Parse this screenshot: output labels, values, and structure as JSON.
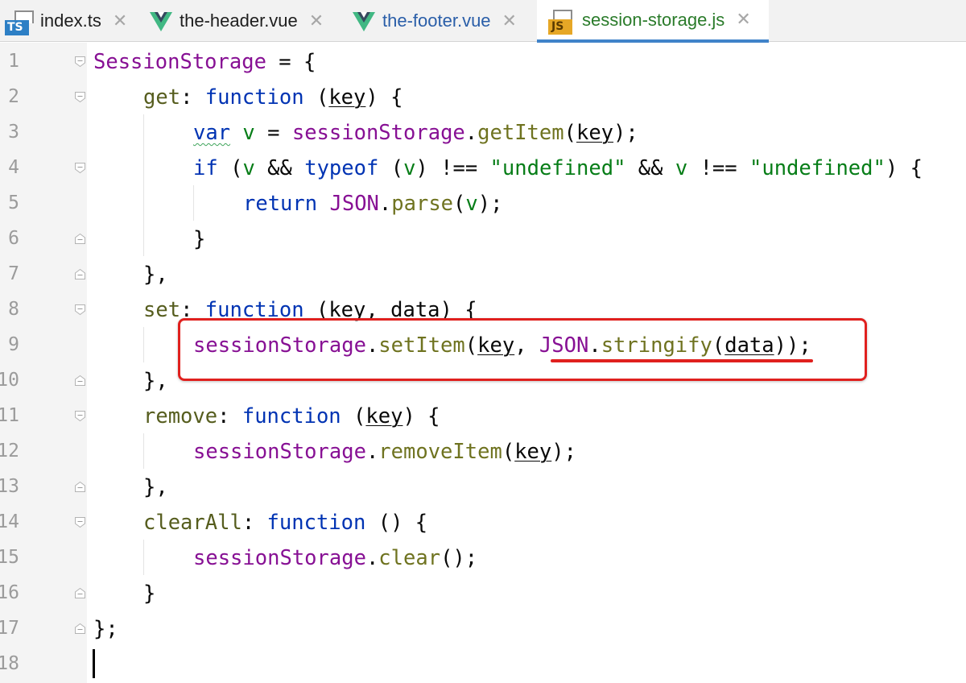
{
  "tabs": [
    {
      "label": "index.ts",
      "type": "ts",
      "icon_text": "TS",
      "active": false
    },
    {
      "label": "the-header.vue",
      "type": "vue",
      "active": false
    },
    {
      "label": "the-footer.vue",
      "type": "vue",
      "active": false
    },
    {
      "label": "session-storage.js",
      "type": "js",
      "icon_text": "JS",
      "active": true
    }
  ],
  "close_glyph": "✕",
  "line_numbers": [
    "1",
    "2",
    "3",
    "4",
    "5",
    "6",
    "7",
    "8",
    "9",
    "10",
    "11",
    "12",
    "13",
    "14",
    "15",
    "16",
    "17",
    "18"
  ],
  "code": {
    "l1": [
      "SessionStorage",
      " = {"
    ],
    "l2": [
      "get",
      ": ",
      "function",
      " (",
      "key",
      ") {"
    ],
    "l3": [
      "var",
      " ",
      "v",
      " = ",
      "sessionStorage",
      ".",
      "getItem",
      "(",
      "key",
      ");"
    ],
    "l4": [
      "if",
      " (",
      "v",
      " && ",
      "typeof",
      " (",
      "v",
      ") !== ",
      "\"undefined\"",
      " && ",
      "v",
      " !== ",
      "\"undefined\"",
      ") {"
    ],
    "l5": [
      "return",
      " ",
      "JSON",
      ".",
      "parse",
      "(",
      "v",
      ");"
    ],
    "l6": [
      "}"
    ],
    "l7": [
      "},"
    ],
    "l8": [
      "set",
      ": ",
      "function",
      " (",
      "key",
      ", ",
      "data",
      ") {"
    ],
    "l9": [
      "sessionStorage",
      ".",
      "setItem",
      "(",
      "key",
      ", ",
      "JSON",
      ".",
      "stringify",
      "(",
      "data",
      "));"
    ],
    "l10": [
      "},"
    ],
    "l11": [
      "remove",
      ": ",
      "function",
      " (",
      "key",
      ") {"
    ],
    "l12": [
      "sessionStorage",
      ".",
      "removeItem",
      "(",
      "key",
      ");"
    ],
    "l13": [
      "},"
    ],
    "l14": [
      "clearAll",
      ": ",
      "function",
      " () {"
    ],
    "l15": [
      "sessionStorage",
      ".",
      "clear",
      "();"
    ],
    "l16": [
      "}"
    ],
    "l17": [
      "};"
    ]
  },
  "colors": {
    "annotation": "#e0201e",
    "active_tab_underline": "#4083c9",
    "current_line": "#fcfae6",
    "keyword": "#0033b3",
    "string": "#067d17",
    "object": "#871094"
  }
}
